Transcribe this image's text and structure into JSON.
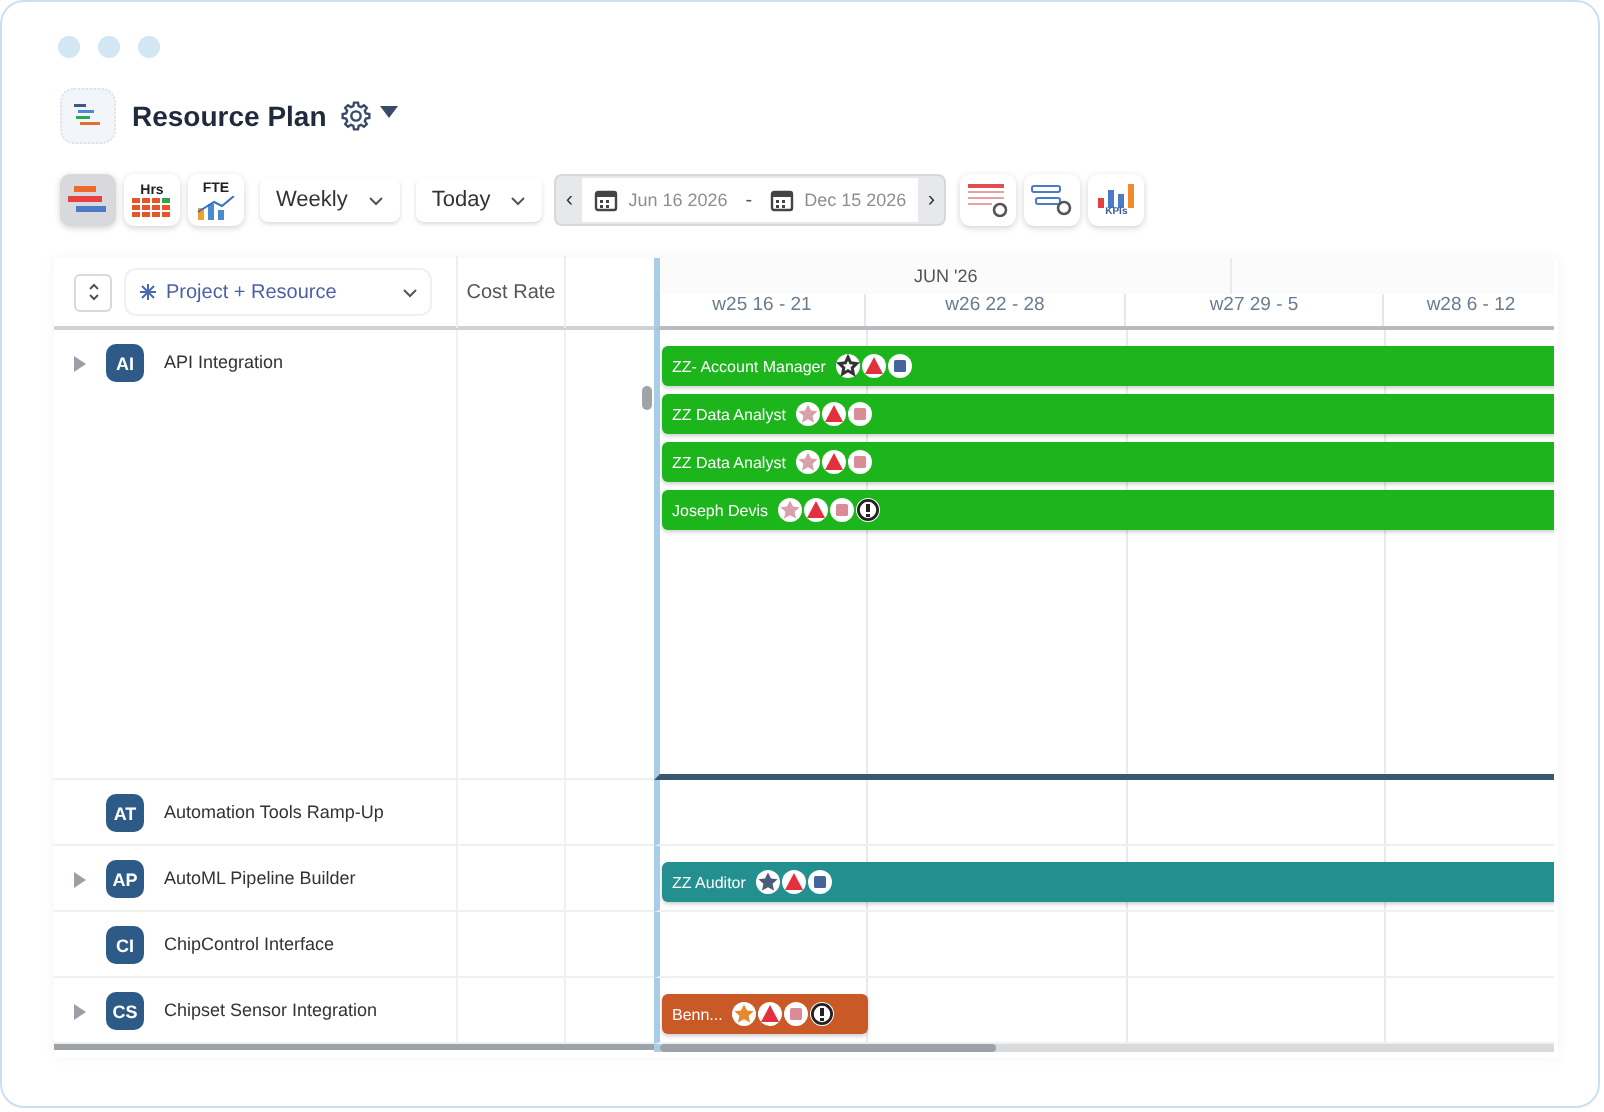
{
  "window": {
    "title": "Resource Plan"
  },
  "toolbar": {
    "view_buttons": [
      {
        "kind": "gantt",
        "selected": true
      },
      {
        "kind": "hours",
        "label": "Hrs",
        "selected": false
      },
      {
        "kind": "fte",
        "label": "FTE",
        "selected": false
      }
    ],
    "interval": "Weekly",
    "jump": "Today",
    "prev": "‹",
    "next": "›",
    "date_start": "Jun 16 2026",
    "date_separator": "-",
    "date_end": "Dec 15 2026",
    "tool_buttons": [
      {
        "kind": "calendar-settings"
      },
      {
        "kind": "bar-settings"
      },
      {
        "kind": "kpis",
        "label": "KPIs"
      }
    ]
  },
  "grid": {
    "group_by": "Project + Resource",
    "columns": [
      {
        "label": "Cost Rate"
      }
    ],
    "month": "JUN '26",
    "weeks": [
      "w25 16 - 21",
      "w26 22 - 28",
      "w27 29 - 5",
      "w28 6 - 12"
    ]
  },
  "projects": [
    {
      "initials": "AI",
      "name": "API Integration",
      "expandable": true,
      "expanded": true,
      "bars": [
        {
          "label": "ZZ- Account Manager",
          "color": "#1cb51c",
          "kind": "full",
          "icons": [
            {
              "kind": "star-outline",
              "color": "#333333"
            },
            {
              "kind": "triangle",
              "color": "#e2303c"
            },
            {
              "kind": "square",
              "color": "#44649a"
            }
          ]
        },
        {
          "label": "ZZ Data Analyst",
          "color": "#1cb51c",
          "kind": "full",
          "icons": [
            {
              "kind": "star",
              "color": "#d9a1a9"
            },
            {
              "kind": "triangle",
              "color": "#e2303c"
            },
            {
              "kind": "square",
              "color": "#d98b96"
            }
          ]
        },
        {
          "label": "ZZ Data Analyst",
          "color": "#1cb51c",
          "kind": "full",
          "icons": [
            {
              "kind": "star",
              "color": "#d9a1a9"
            },
            {
              "kind": "triangle",
              "color": "#e2303c"
            },
            {
              "kind": "square",
              "color": "#d98b96"
            }
          ]
        },
        {
          "label": "Joseph Devis",
          "color": "#1cb51c",
          "kind": "full",
          "icons": [
            {
              "kind": "star",
              "color": "#d9a1a9"
            },
            {
              "kind": "triangle",
              "color": "#e2303c"
            },
            {
              "kind": "square",
              "color": "#d98b96"
            },
            {
              "kind": "alert",
              "color": "#222222"
            }
          ]
        }
      ]
    },
    {
      "initials": "AT",
      "name": "Automation Tools Ramp-Up",
      "expandable": false,
      "expanded": false
    },
    {
      "initials": "AP",
      "name": "AutoML Pipeline Builder",
      "expandable": true,
      "expanded": false,
      "bars": [
        {
          "label": "ZZ Auditor",
          "color": "#238f8e",
          "kind": "full",
          "icons": [
            {
              "kind": "star",
              "color": "#4b5b78"
            },
            {
              "kind": "triangle",
              "color": "#e2303c"
            },
            {
              "kind": "square",
              "color": "#44649a"
            }
          ]
        }
      ]
    },
    {
      "initials": "CI",
      "name": "ChipControl Interface",
      "expandable": false,
      "expanded": false
    },
    {
      "initials": "CS",
      "name": "Chipset Sensor Integration",
      "expandable": true,
      "expanded": false,
      "bars": [
        {
          "label": "Benn...",
          "color": "#c95a27",
          "kind": "short",
          "icons": [
            {
              "kind": "star",
              "color": "#e8892c"
            },
            {
              "kind": "triangle",
              "color": "#e2303c"
            },
            {
              "kind": "square",
              "color": "#d98b96"
            },
            {
              "kind": "alert",
              "color": "#222222"
            }
          ]
        }
      ]
    }
  ]
}
